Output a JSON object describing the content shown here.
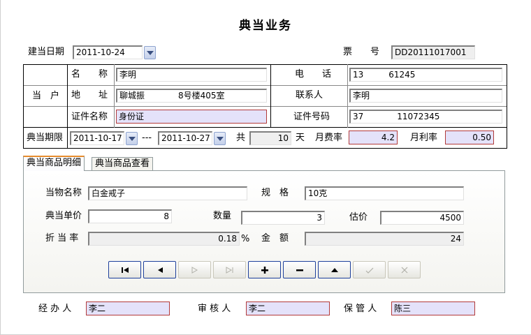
{
  "window": {
    "title": "典当业务"
  },
  "header": {
    "date_label": "建当日期",
    "date_value": "2011-10-24",
    "ticket_label": "票　　号",
    "ticket_value": "DD20111017001"
  },
  "pawner": {
    "group_label": "当　户",
    "name_label": "名　　称",
    "name_value": "李明",
    "address_label": "地　　址",
    "address_value": "聊城振　　　　8号楼405室",
    "idtype_label": "证件名称",
    "idtype_value": "身份证",
    "phone_label": "电　　话",
    "phone_value": "13　　　61245",
    "contact_label": "联系人",
    "contact_value": "李明",
    "idno_label": "证件号码",
    "idno_value": "37　　　　11072345"
  },
  "term": {
    "label": "典当期限",
    "start": "2011-10-17",
    "sep": "---",
    "end": "2011-10-27",
    "total_label": "共",
    "days": "10",
    "days_unit": "天",
    "fee_rate_label": "月费率",
    "fee_rate": "4.2",
    "interest_label": "月利率",
    "interest": "0.50"
  },
  "tabs": [
    {
      "label": "典当商品明细"
    },
    {
      "label": "典当商品查看"
    }
  ],
  "detail": {
    "item_name_label": "当物名称",
    "item_name": "白金戒子",
    "spec_label": "规　格",
    "spec": "10克",
    "unit_price_label": "典当单价",
    "unit_price": "8",
    "qty_label": "数量",
    "qty": "3",
    "estimate_label": "估价",
    "estimate": "4500",
    "discount_label": "折 当 率",
    "discount": "0.18",
    "discount_unit": "%",
    "amount_label": "金　额",
    "amount": "24"
  },
  "footer": {
    "handler_label": "经 办 人",
    "handler": "李二",
    "reviewer_label": "审 核 人",
    "reviewer": "李二",
    "keeper_label": "保 管 人",
    "keeper": "陈三"
  },
  "colors": {
    "highlight_bg": "#e4e2fa",
    "highlight_border": "#b23a3a",
    "button_border": "#1d3f9b",
    "tab_accent": "#e68b2c"
  },
  "nav_buttons": [
    {
      "icon": "first-record-icon",
      "enabled": true
    },
    {
      "icon": "prev-record-icon",
      "enabled": true
    },
    {
      "icon": "next-record-icon",
      "enabled": false
    },
    {
      "icon": "last-record-icon",
      "enabled": false
    },
    {
      "icon": "add-icon",
      "enabled": true
    },
    {
      "icon": "delete-icon",
      "enabled": true
    },
    {
      "icon": "edit-up-icon",
      "enabled": true
    },
    {
      "icon": "save-check-icon",
      "enabled": false
    },
    {
      "icon": "cancel-x-icon",
      "enabled": false
    }
  ]
}
